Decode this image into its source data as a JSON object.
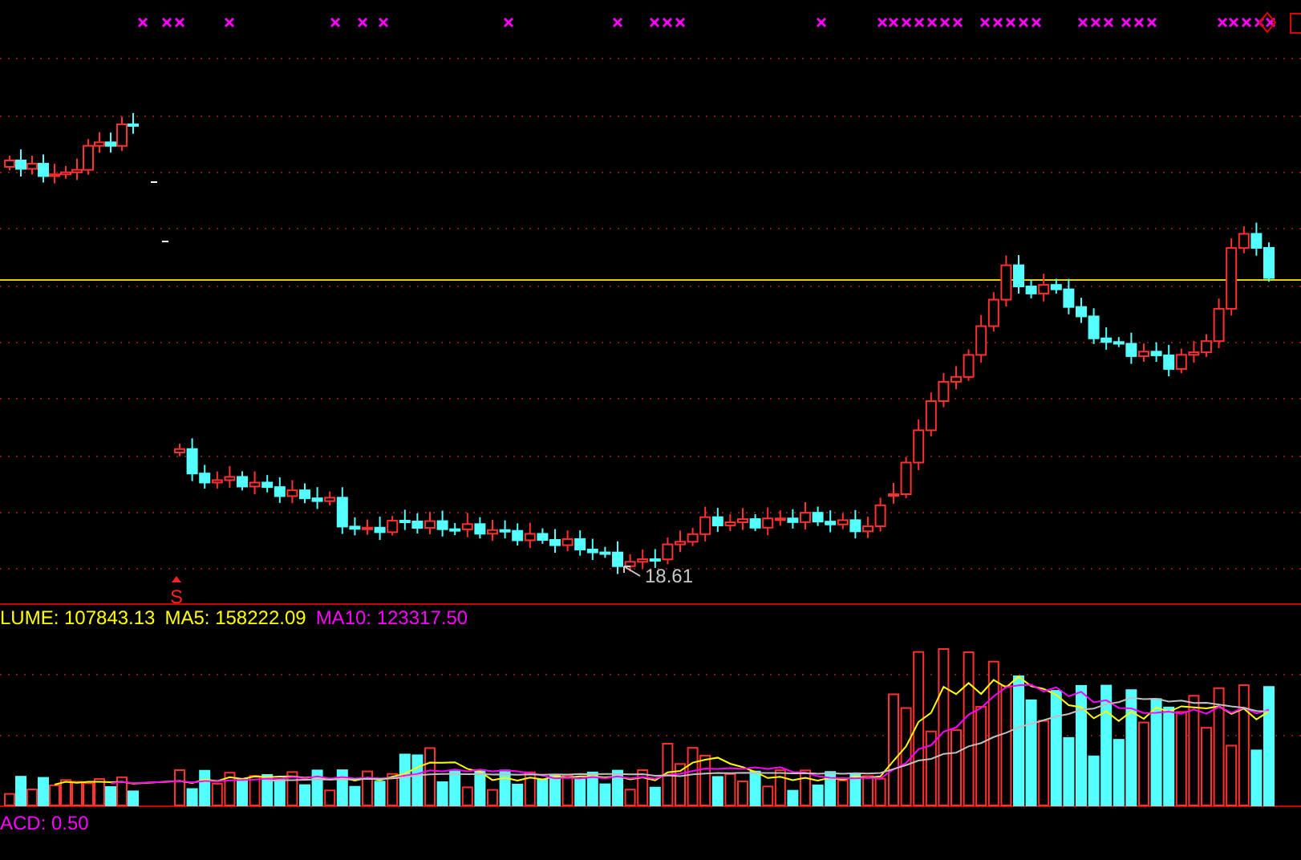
{
  "price_panel": {
    "low_price_label": "18.61",
    "signal_marker": "S"
  },
  "volume_panel": {
    "legend": [
      {
        "text": "LUME: 107843.13",
        "color": "#ffff00"
      },
      {
        "text": "MA5: 158222.09",
        "color": "#ffff00"
      },
      {
        "text": "MA10: 123317.50",
        "color": "#ff00ff"
      }
    ]
  },
  "macd_panel": {
    "label": "ACD: 0.50"
  }
}
